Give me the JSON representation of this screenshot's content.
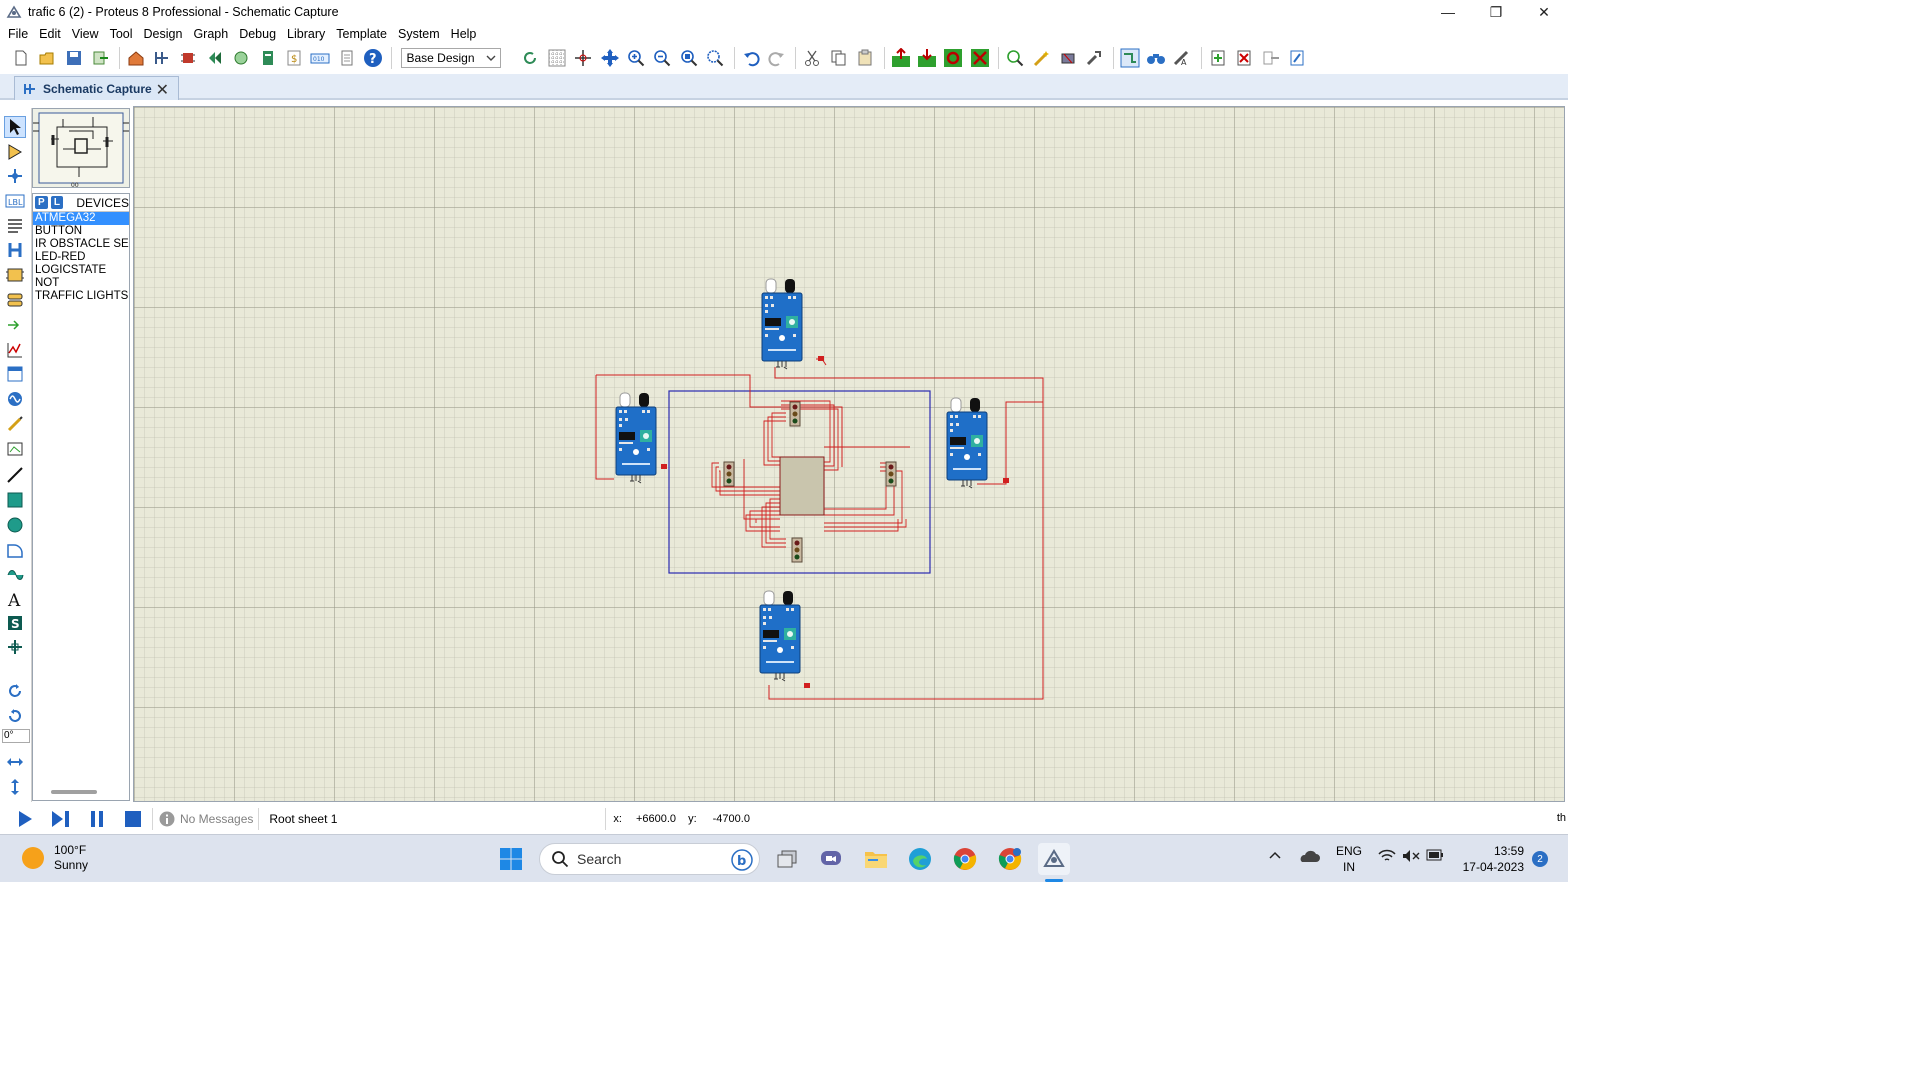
{
  "window": {
    "title": "trafic 6 (2) - Proteus 8 Professional - Schematic Capture",
    "controls": [
      "—",
      "❐",
      "✕"
    ]
  },
  "menu": [
    "File",
    "Edit",
    "View",
    "Tool",
    "Design",
    "Graph",
    "Debug",
    "Library",
    "Template",
    "System",
    "Help"
  ],
  "toolbar": {
    "design_variant": "Base Design"
  },
  "tab": {
    "label": "Schematic Capture",
    "close": "✕"
  },
  "tools": {
    "rotation_angle": "0°"
  },
  "device_panel": {
    "p_button": "P",
    "l_button": "L",
    "title": "DEVICES",
    "items": [
      "ATMEGA32",
      "BUTTON",
      "IR OBSTACLE SENSOR",
      "LED-RED",
      "LOGICSTATE",
      "NOT",
      "TRAFFIC LIGHTS"
    ],
    "selected_index": 0
  },
  "overview": {
    "label": "00"
  },
  "schematic": {
    "sensor_label": "Infrared Sensor"
  },
  "status": {
    "messages": "No Messages",
    "sheet": "Root sheet 1",
    "x_label": "x:",
    "x_value": "+6600.0",
    "y_label": "y:",
    "y_value": "-4700.0",
    "right_fragment": "th"
  },
  "taskbar": {
    "weather_temp": "100°F",
    "weather_desc": "Sunny",
    "search_placeholder": "Search",
    "language": "ENG",
    "region": "IN",
    "time": "13:59",
    "date": "17-04-2023",
    "notifications": "2"
  },
  "colors": {
    "accent": "#2b6fc4",
    "wire": "#d11f1f",
    "box": "#2a2ab0",
    "sensor_board": "#1f6fc8",
    "grid_bg": "#e9e9d8"
  }
}
